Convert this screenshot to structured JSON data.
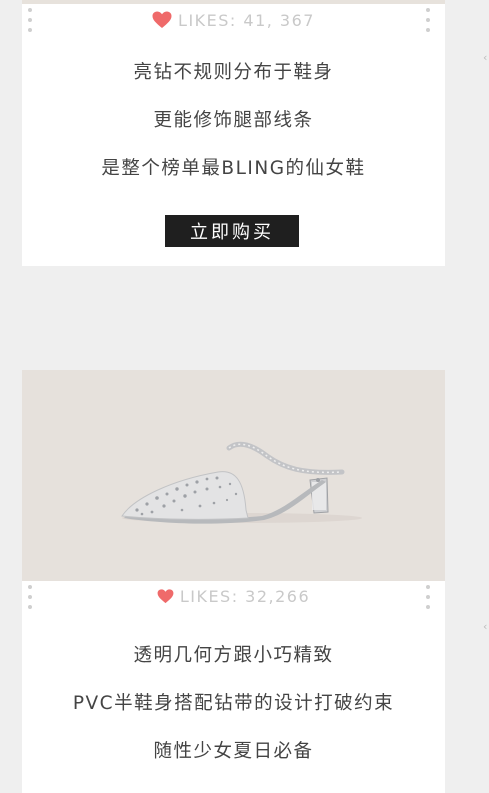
{
  "accent_color": "#e95b5b",
  "cards": [
    {
      "likes_label": "LIKES: 41, 367",
      "description": [
        "亮钻不规则分布于鞋身",
        "更能修饰腿部线条",
        "是整个榜单最BLING的仙女鞋"
      ],
      "buy_button_label": "立即购买"
    },
    {
      "image_alt": "Transparent pointed-toe rhinestone slingback mule",
      "likes_label": "LIKES: 32,266",
      "description": [
        "透明几何方跟小巧精致",
        "PVC半鞋身搭配钻带的设计打破约束",
        "随性少女夏日必备"
      ]
    }
  ],
  "icons": {
    "heart": "heart-icon",
    "more": "vertical-dots-icon",
    "edge": "chevron-left-icon"
  }
}
